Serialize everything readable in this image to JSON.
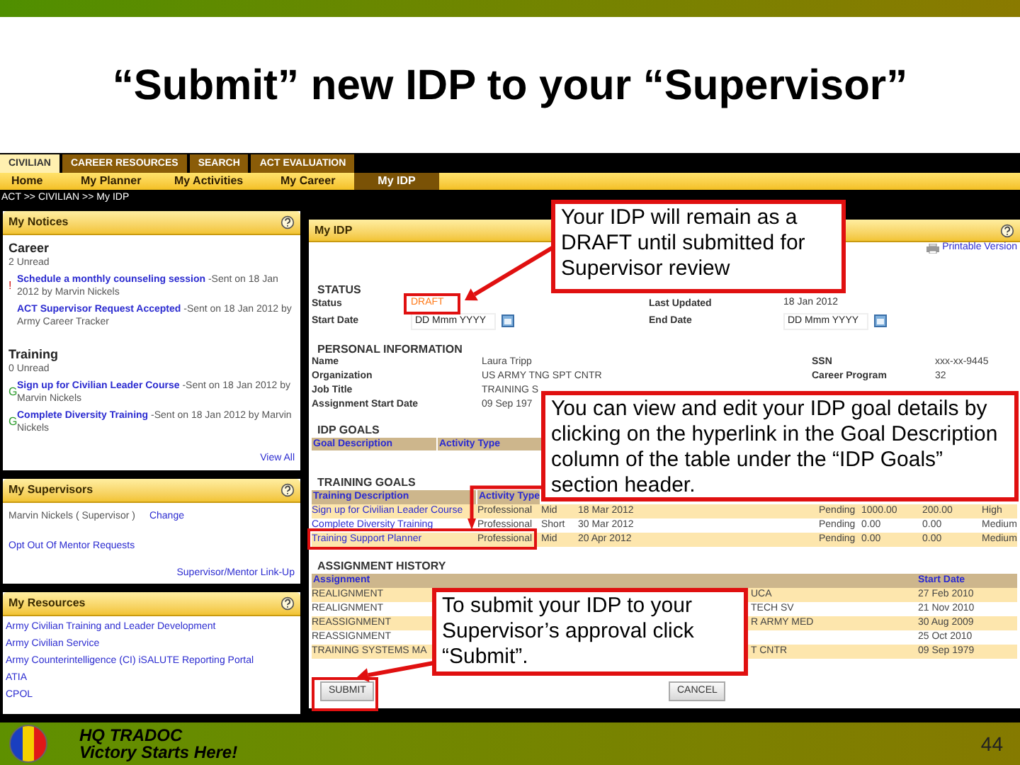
{
  "slide": {
    "title": "“Submit” new IDP to your “Supervisor”",
    "footer_org": "HQ TRADOC",
    "footer_motto": "Victory Starts Here!",
    "page_number": "44"
  },
  "nav_tabs": [
    {
      "label": "CIVILIAN",
      "selected": true
    },
    {
      "label": "CAREER RESOURCES",
      "selected": false
    },
    {
      "label": "SEARCH",
      "selected": false
    },
    {
      "label": "ACT EVALUATION",
      "selected": false
    }
  ],
  "menu": [
    {
      "label": "Home",
      "selected": false
    },
    {
      "label": "My Planner",
      "selected": false
    },
    {
      "label": "My Activities",
      "selected": false
    },
    {
      "label": "My Career",
      "selected": false
    },
    {
      "label": "My IDP",
      "selected": true
    }
  ],
  "breadcrumb": "ACT >> CIVILIAN >> My IDP",
  "notices": {
    "title": "My Notices",
    "groups": [
      {
        "name": "Career",
        "unread": "2 Unread",
        "items": [
          {
            "flag": "!",
            "kind": "alert",
            "link": "Schedule a monthly counseling session",
            "text": "-Sent on 18 Jan 2012 by Marvin Nickels"
          },
          {
            "link": "ACT Supervisor Request Accepted",
            "text": "-Sent on 18 Jan 2012 by Army Career Tracker"
          }
        ]
      },
      {
        "name": "Training",
        "unread": "0 Unread",
        "items": [
          {
            "flag": "G",
            "kind": "goal",
            "link": "Sign up for Civilian Leader Course",
            "text": "-Sent on 18 Jan 2012 by Marvin Nickels"
          },
          {
            "flag": "G",
            "kind": "goal",
            "link": "Complete Diversity Training",
            "text": "-Sent on 18 Jan 2012 by Marvin Nickels"
          }
        ]
      }
    ],
    "view_all": "View All"
  },
  "supervisors": {
    "title": "My Supervisors",
    "supervisor": "Marvin Nickels ( Supervisor )",
    "change": "Change",
    "opt_out": "Opt Out Of Mentor Requests",
    "link_up": "Supervisor/Mentor Link-Up"
  },
  "resources": {
    "title": "My Resources",
    "links": [
      "Army Civilian Training and Leader Development",
      "Army Civilian Service",
      "Army Counterintelligence (CI) iSALUTE Reporting Portal",
      "ATIA",
      "CPOL"
    ]
  },
  "idp": {
    "title": "My IDP",
    "printable": "Printable Version",
    "status": {
      "heading": "STATUS",
      "fields": [
        {
          "label": "Status",
          "kind": "status",
          "value": "DRAFT"
        },
        {
          "label": "Last Updated",
          "kind": "text",
          "value": "18 Jan 2012"
        },
        {
          "label": "Start Date",
          "kind": "date",
          "value": "DD Mmm YYYY"
        },
        {
          "label": "End Date",
          "kind": "date",
          "value": "DD Mmm YYYY"
        }
      ]
    },
    "personal": {
      "heading": "PERSONAL INFORMATION",
      "rows": [
        [
          {
            "label": "Name",
            "value": "Laura Tripp"
          },
          {
            "label": "SSN",
            "value": "xxx-xx-9445"
          }
        ],
        [
          {
            "label": "Organization",
            "value": "US ARMY TNG SPT CNTR"
          },
          {
            "label": "Career Program",
            "value": "32"
          }
        ],
        [
          {
            "label": "Job Title",
            "value": "TRAINING S"
          }
        ],
        [
          {
            "label": "Assignment Start Date",
            "value": "09 Sep 197"
          }
        ]
      ]
    },
    "idp_goals": {
      "heading": "IDP GOALS",
      "columns": [
        "Goal Description",
        "Activity Type"
      ]
    },
    "training_goals": {
      "heading": "TRAINING GOALS",
      "columns": [
        "Training Description",
        "Activity Type"
      ],
      "rows": [
        {
          "description": "Sign up for Civilian Leader Course",
          "activity_type": "Professional",
          "term": "Mid",
          "date": "18 Mar 2012",
          "status": "Pending",
          "cost_1": "1000.00",
          "cost_2": "200.00",
          "priority": "High"
        },
        {
          "description": "Complete Diversity Training",
          "activity_type": "Professional",
          "term": "Short",
          "date": "30 Mar 2012",
          "status": "Pending",
          "cost_1": "0.00",
          "cost_2": "0.00",
          "priority": "Medium"
        },
        {
          "description": "Training Support Planner",
          "activity_type": "Professional",
          "term": "Mid",
          "date": "20 Apr 2012",
          "status": "Pending",
          "cost_1": "0.00",
          "cost_2": "0.00",
          "priority": "Medium"
        }
      ]
    },
    "assignment_history": {
      "heading": "ASSIGNMENT HISTORY",
      "columns": {
        "assignment": "Assignment",
        "start_date": "Start Date"
      },
      "rows": [
        {
          "assignment": "REALIGNMENT",
          "organization": "UCA",
          "start_date": "27 Feb 2010"
        },
        {
          "assignment": "REALIGNMENT",
          "organization": "TECH SV",
          "start_date": "21 Nov 2010"
        },
        {
          "assignment": "REASSIGNMENT",
          "organization": "R ARMY MED",
          "start_date": "30 Aug 2009"
        },
        {
          "assignment": "REASSIGNMENT",
          "start_date": "25 Oct 2010"
        },
        {
          "assignment": "TRAINING SYSTEMS MA",
          "organization": "T CNTR",
          "start_date": "09 Sep 1979"
        }
      ]
    },
    "buttons": {
      "submit": "SUBMIT",
      "cancel": "CANCEL"
    }
  },
  "callouts": [
    {
      "text": "Your IDP will remain as a DRAFT until submitted for Supervisor review"
    },
    {
      "text": "You can view and edit your IDP goal details by clicking on the hyperlink in the Goal Description column of the table under the “IDP Goals” section header."
    },
    {
      "text": "To submit your IDP to your Supervisor’s approval click “Submit”."
    }
  ]
}
